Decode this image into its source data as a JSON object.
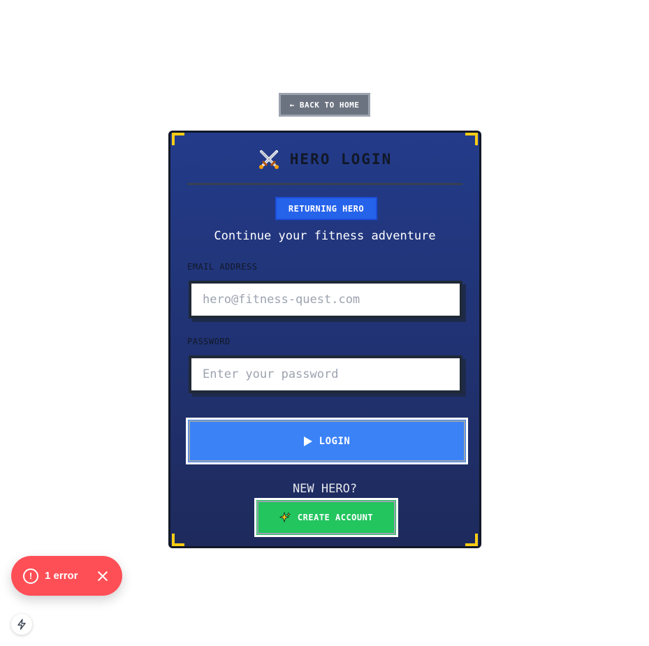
{
  "nav": {
    "back_label": "← BACK TO HOME"
  },
  "card": {
    "icon": "crossed-swords-icon",
    "title": "HERO LOGIN",
    "badge": "RETURNING HERO",
    "subtitle": "Continue your fitness adventure",
    "email": {
      "label": "EMAIL ADDRESS",
      "placeholder": "hero@fitness-quest.com",
      "value": ""
    },
    "password": {
      "label": "PASSWORD",
      "placeholder": "Enter your password",
      "value": ""
    },
    "login_label": "LOGIN",
    "new_hero_text": "NEW HERO?",
    "create_icon": "sparkles-icon",
    "create_label": "CREATE ACCOUNT"
  },
  "error_toast": {
    "text": "1 error",
    "icon": "alert-circle-icon"
  },
  "dev_tools": {
    "icon": "lightning-bolt-icon"
  },
  "colors": {
    "card_top": "#233b8a",
    "card_bottom": "#1e2a5c",
    "corner_accent": "#facc15",
    "login_button": "#3b82f6",
    "create_button": "#22c55e",
    "badge": "#2563eb",
    "error": "#ff4f56"
  }
}
